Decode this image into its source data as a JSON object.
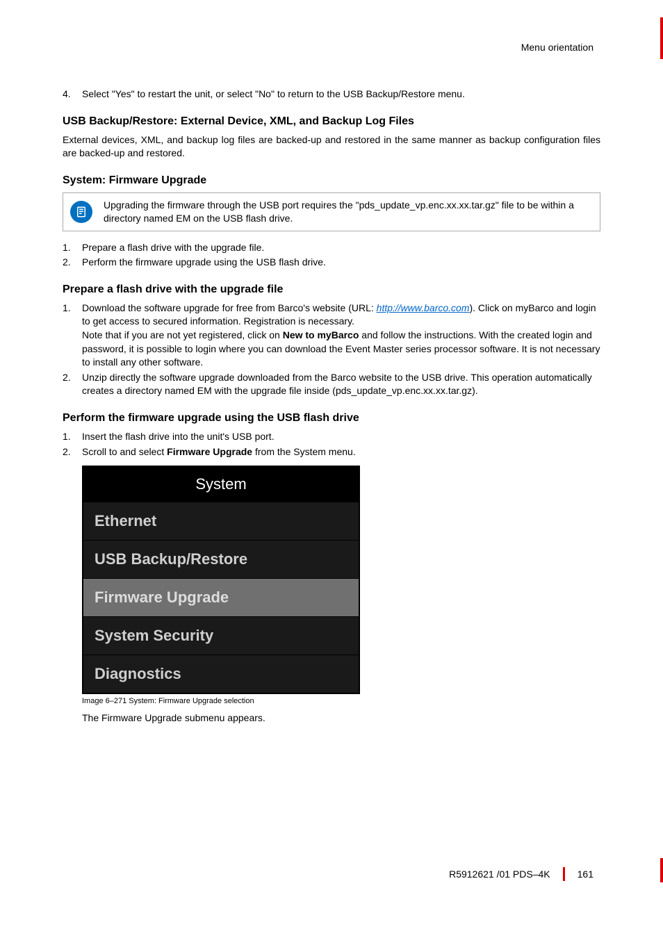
{
  "header": {
    "section": "Menu orientation"
  },
  "step4": {
    "num": "4.",
    "text": "Select \"Yes\" to restart the unit, or select \"No\" to return to the USB Backup/Restore menu."
  },
  "usb_backup": {
    "heading": "USB Backup/Restore: External Device, XML, and Backup Log Files",
    "para": "External devices, XML, and backup log files are backed-up and restored in the same manner as backup configuration files are backed-up and restored."
  },
  "firmware": {
    "heading": "System: Firmware Upgrade",
    "note": "Upgrading the firmware through the USB port requires the \"pds_update_vp.enc.xx.xx.tar.gz\" file to be within a directory named EM on the USB flash drive.",
    "steps": [
      {
        "num": "1.",
        "text": "Prepare a flash drive with the upgrade file."
      },
      {
        "num": "2.",
        "text": "Perform the firmware upgrade using the USB flash drive."
      }
    ]
  },
  "prepare": {
    "heading": "Prepare a flash drive with the upgrade file",
    "step1": {
      "num": "1.",
      "pre": "Download the software upgrade for free from Barco's website (URL: ",
      "link": "http://www.barco.com",
      "post": "). Click on myBarco and login to get access to secured information. Registration is necessary.",
      "note_pre": "Note that if you are not yet registered, click on ",
      "note_bold": "New to myBarco",
      "note_post": " and follow the instructions. With the created login and password, it is possible to login where you can download the Event Master series processor software. It is not necessary to install any other software."
    },
    "step2": {
      "num": "2.",
      "text": "Unzip directly the software upgrade downloaded from the Barco website to the USB drive. This operation automatically creates a directory named EM with the upgrade file inside (pds_update_vp.enc.xx.xx.tar.gz)."
    }
  },
  "perform": {
    "heading": "Perform the firmware upgrade using the USB flash drive",
    "step1": {
      "num": "1.",
      "text": "Insert the flash drive into the unit's USB port."
    },
    "step2": {
      "num": "2.",
      "pre": "Scroll to and select ",
      "bold": "Firmware Upgrade",
      "post": " from the System menu."
    }
  },
  "menu": {
    "title": "System",
    "items": [
      "Ethernet",
      "USB Backup/Restore",
      "Firmware Upgrade",
      "System Security",
      "Diagnostics"
    ],
    "selected_index": 2
  },
  "caption": "Image 6–271  System: Firmware Upgrade selection",
  "after_caption": "The Firmware Upgrade submenu appears.",
  "footer": {
    "doc": "R5912621 /01 PDS–4K",
    "page": "161"
  }
}
